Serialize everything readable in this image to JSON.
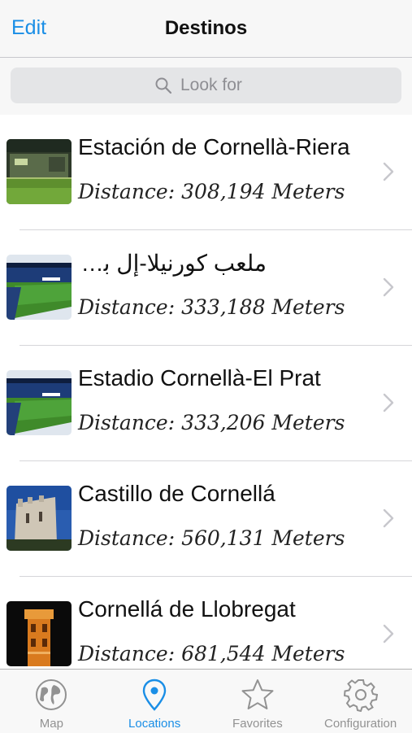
{
  "nav": {
    "edit_label": "Edit",
    "title": "Destinos"
  },
  "search": {
    "placeholder": "Look for",
    "value": ""
  },
  "locations": [
    {
      "name": "Estación de Cornellà-Riera",
      "distance": "Distance: 308,194 Meters",
      "thumb": "station-photo",
      "rtl": false
    },
    {
      "name": "ملعب كورنيلا-إل برات",
      "distance": "Distance: 333,188 Meters",
      "thumb": "stadium-photo",
      "rtl": true
    },
    {
      "name": "Estadio Cornellà-El Prat",
      "distance": "Distance: 333,206 Meters",
      "thumb": "stadium-photo",
      "rtl": false
    },
    {
      "name": "Castillo de Cornellá",
      "distance": "Distance: 560,131 Meters",
      "thumb": "castle-photo",
      "rtl": false
    },
    {
      "name": "Cornellá de Llobregat",
      "distance": "Distance: 681,544 Meters",
      "thumb": "tower-photo",
      "rtl": false
    }
  ],
  "tabs": [
    {
      "label": "Map",
      "icon": "globe-icon",
      "active": false
    },
    {
      "label": "Locations",
      "icon": "location-pin-icon",
      "active": true
    },
    {
      "label": "Favorites",
      "icon": "star-icon",
      "active": false
    },
    {
      "label": "Configuration",
      "icon": "gear-icon",
      "active": false
    }
  ],
  "colors": {
    "accent": "#1a8ee6",
    "inactive": "#929292",
    "bar": "#f7f7f7"
  }
}
